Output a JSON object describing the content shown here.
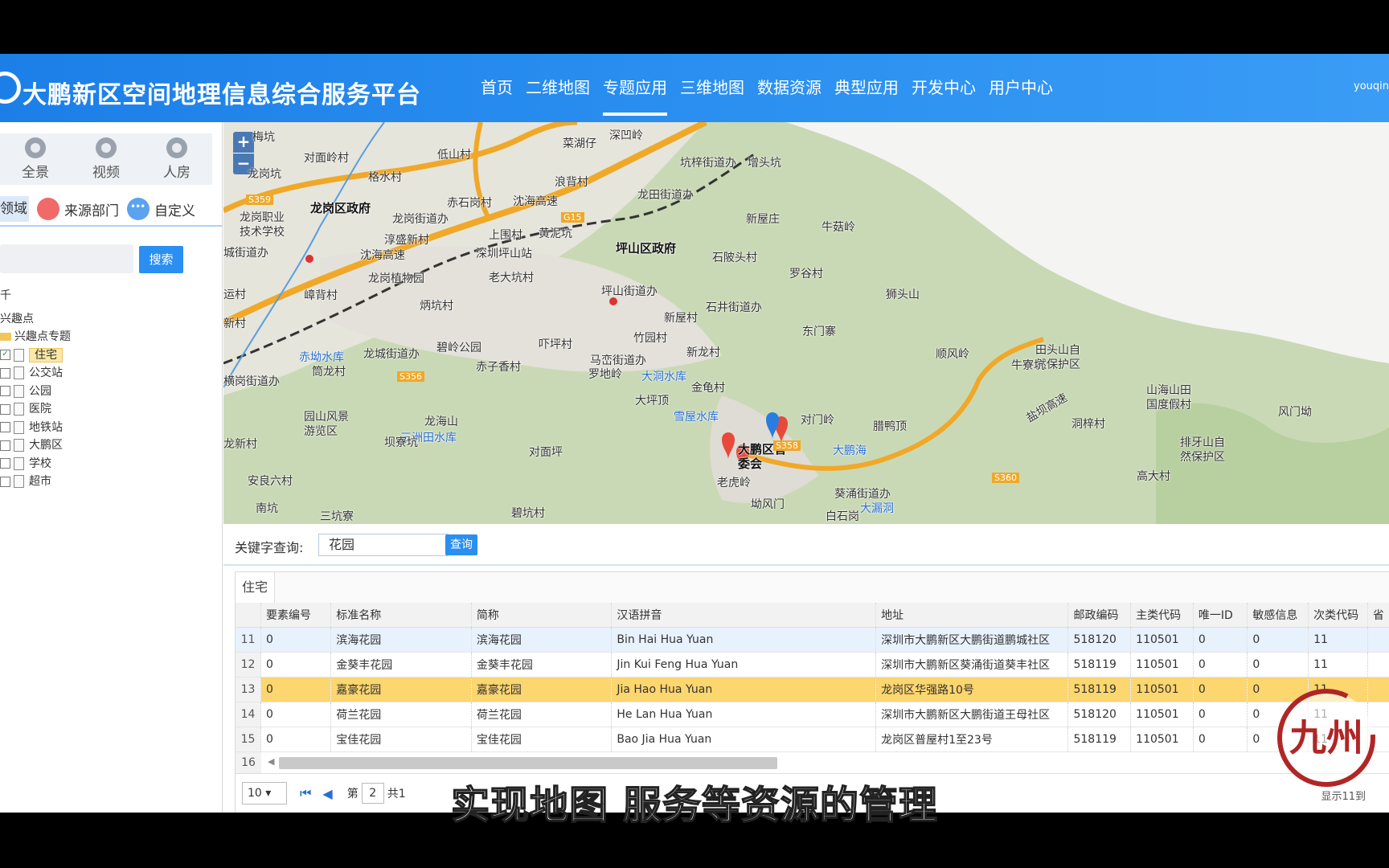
{
  "header": {
    "title": "大鹏新区空间地理信息综合服务平台",
    "nav": [
      "首页",
      "二维地图",
      "专题应用",
      "三维地图",
      "数据资源",
      "典型应用",
      "开发中心",
      "用户中心"
    ],
    "active_nav": "专题应用",
    "user": "youqin"
  },
  "left": {
    "icon_tabs": [
      {
        "label": "全景",
        "icon": "panorama-icon"
      },
      {
        "label": "视频",
        "icon": "video-icon"
      },
      {
        "label": "人房",
        "icon": "house-icon"
      }
    ],
    "filters": {
      "domain": "领域",
      "source": "来源部门",
      "custom": "自定义"
    },
    "search_button": "搜索",
    "tree": {
      "root_fragment": "千",
      "poi": "兴趣点",
      "folder": "兴趣点专题",
      "items": [
        {
          "label": "住宅",
          "checked": true
        },
        {
          "label": "公交站",
          "checked": false
        },
        {
          "label": "公园",
          "checked": false
        },
        {
          "label": "医院",
          "checked": false
        },
        {
          "label": "地铁站",
          "checked": false
        },
        {
          "label": "大鹏区",
          "checked": false
        },
        {
          "label": "学校",
          "checked": false
        },
        {
          "label": "超市",
          "checked": false
        }
      ]
    }
  },
  "map": {
    "zoom_in": "+",
    "zoom_out": "−",
    "labels": [
      {
        "text": "龙岗区政府",
        "bold": true
      },
      {
        "text": "坪山区政府",
        "bold": true
      },
      {
        "text": "大鹏区管委会",
        "bold": true
      },
      {
        "text": "沈海高速",
        "bold": false
      },
      {
        "text": "沈海高速",
        "bold": false
      },
      {
        "text": "龙田街道办",
        "bold": false
      },
      {
        "text": "坑梓街道办",
        "bold": false
      },
      {
        "text": "坪山街道办",
        "bold": false
      },
      {
        "text": "石井街道办",
        "bold": false
      },
      {
        "text": "马峦街道办",
        "bold": false
      },
      {
        "text": "葵涌街道办",
        "bold": false
      },
      {
        "text": "龙岗街道办",
        "bold": false
      },
      {
        "text": "龙岗植物园",
        "bold": false
      },
      {
        "text": "深圳坪山站",
        "bold": false
      },
      {
        "text": "老大坑村",
        "bold": false
      },
      {
        "text": "田头山自然保护区",
        "bold": false
      },
      {
        "text": "山海山田国度假村",
        "bold": false
      },
      {
        "text": "排牙山自然保护区",
        "bold": false
      },
      {
        "text": "金龟村",
        "bold": false
      },
      {
        "text": "大坪顶",
        "bold": false
      },
      {
        "text": "对门岭",
        "bold": false
      },
      {
        "text": "腊鸭顶",
        "bold": false
      },
      {
        "text": "牛寮坑",
        "bold": false
      },
      {
        "text": "洞梓村",
        "bold": false
      },
      {
        "text": "风门坳",
        "bold": false
      },
      {
        "text": "高大村",
        "bold": false
      },
      {
        "text": "白石岗",
        "bold": false
      },
      {
        "text": "坳风门",
        "bold": false
      },
      {
        "text": "老虎岭",
        "bold": false
      },
      {
        "text": "园山风景游览区",
        "bold": false
      },
      {
        "text": "安良六村",
        "bold": false
      },
      {
        "text": "三坑寮",
        "bold": false
      },
      {
        "text": "筒龙村",
        "bold": false
      },
      {
        "text": "碧岭公园",
        "bold": false
      },
      {
        "text": "赤子香村",
        "bold": false
      },
      {
        "text": "罗地岭",
        "bold": false
      },
      {
        "text": "吓坪村",
        "bold": false
      },
      {
        "text": "竹园村",
        "bold": false
      },
      {
        "text": "新屋村",
        "bold": false
      },
      {
        "text": "新龙村",
        "bold": false
      },
      {
        "text": "石陂头村",
        "bold": false
      },
      {
        "text": "罗谷村",
        "bold": false
      },
      {
        "text": "牛菇岭",
        "bold": false
      },
      {
        "text": "东门寨",
        "bold": false
      },
      {
        "text": "顺风岭",
        "bold": false
      },
      {
        "text": "狮头山",
        "bold": false
      },
      {
        "text": "浪背村",
        "bold": false
      },
      {
        "text": "赤石岗村",
        "bold": false
      },
      {
        "text": "低山村",
        "bold": false
      },
      {
        "text": "格水村",
        "bold": false
      },
      {
        "text": "对面岭村",
        "bold": false
      },
      {
        "text": "深凹岭",
        "bold": false
      },
      {
        "text": "菜湖仔",
        "bold": false
      },
      {
        "text": "增头坑",
        "bold": false
      },
      {
        "text": "上围村",
        "bold": false
      },
      {
        "text": "黄泥坑",
        "bold": false
      },
      {
        "text": "龙岗职业技术学校",
        "bold": false
      },
      {
        "text": "淳盛新村",
        "bold": false
      },
      {
        "text": "嶂背村",
        "bold": false
      },
      {
        "text": "炳坑村",
        "bold": false
      },
      {
        "text": "龙岗坑",
        "bold": false
      },
      {
        "text": "龙海山",
        "bold": false
      },
      {
        "text": "龙城街道办",
        "bold": false
      },
      {
        "text": "城街道办",
        "bold": false
      },
      {
        "text": "运村",
        "bold": false
      },
      {
        "text": "新村",
        "bold": false
      },
      {
        "text": "龙新村",
        "bold": false
      },
      {
        "text": "大鹏海",
        "bold": false
      },
      {
        "text": "赤坳水库",
        "bold": false
      },
      {
        "text": "三洲田水库",
        "bold": false
      },
      {
        "text": "雪屋水库",
        "bold": false
      },
      {
        "text": "大洞水库",
        "bold": false
      },
      {
        "text": "大漏洞",
        "bold": false
      },
      {
        "text": "碧坑村",
        "bold": false
      },
      {
        "text": "横岗街道办",
        "bold": false
      },
      {
        "text": "梅坑",
        "bold": false
      },
      {
        "text": "G15",
        "bold": false
      },
      {
        "text": "S359",
        "bold": false
      },
      {
        "text": "S356",
        "bold": false
      },
      {
        "text": "S360",
        "bold": false
      },
      {
        "text": "S358",
        "bold": false
      },
      {
        "text": "盐坝高速",
        "bold": false
      },
      {
        "text": "新屋庄",
        "bold": false
      },
      {
        "text": "对面坪",
        "bold": false
      },
      {
        "text": "坝寮坑",
        "bold": false
      },
      {
        "text": "南坑",
        "bold": false
      }
    ]
  },
  "query": {
    "label": "关键字查询:",
    "value": "花园",
    "button": "查询"
  },
  "grid": {
    "tab": "住宅",
    "columns": [
      "",
      "要素编号",
      "标准名称",
      "简称",
      "汉语拼音",
      "地址",
      "邮政编码",
      "主类代码",
      "唯一ID",
      "敏感信息",
      "次类代码",
      "省"
    ],
    "rows": [
      {
        "n": "11",
        "id": "0",
        "name": "滨海花园",
        "short": "滨海花园",
        "pinyin": "Bin Hai Hua Yuan",
        "addr": "深圳市大鹏新区大鹏街道鹏城社区",
        "zip": "518120",
        "main": "110501",
        "uid": "0",
        "sens": "0",
        "sub": "11",
        "state": "hover"
      },
      {
        "n": "12",
        "id": "0",
        "name": "金葵丰花园",
        "short": "金葵丰花园",
        "pinyin": "Jin Kui Feng Hua Yuan",
        "addr": "深圳市大鹏新区葵涌街道葵丰社区",
        "zip": "518119",
        "main": "110501",
        "uid": "0",
        "sens": "0",
        "sub": "11",
        "state": ""
      },
      {
        "n": "13",
        "id": "0",
        "name": "嘉豪花园",
        "short": "嘉豪花园",
        "pinyin": "Jia Hao Hua Yuan",
        "addr": "龙岗区华强路10号",
        "zip": "518119",
        "main": "110501",
        "uid": "0",
        "sens": "0",
        "sub": "11",
        "state": "selected"
      },
      {
        "n": "14",
        "id": "0",
        "name": "荷兰花园",
        "short": "荷兰花园",
        "pinyin": "He Lan Hua Yuan",
        "addr": "深圳市大鹏新区大鹏街道王母社区",
        "zip": "518120",
        "main": "110501",
        "uid": "0",
        "sens": "0",
        "sub": "11",
        "state": ""
      },
      {
        "n": "15",
        "id": "0",
        "name": "宝佳花园",
        "short": "宝佳花园",
        "pinyin": "Bao Jia Hua Yuan",
        "addr": "龙岗区普屋村1至23号",
        "zip": "518119",
        "main": "110501",
        "uid": "0",
        "sens": "0",
        "sub": "11",
        "state": ""
      }
    ],
    "row16": "16",
    "pager": {
      "page_size": "10 ▾",
      "page_prefix": "第",
      "page_value": "2",
      "total_prefix": "共1",
      "right_text": "显示11到"
    }
  },
  "subtitle": "实现地图 服务等资源的管理",
  "watermark": "九州"
}
